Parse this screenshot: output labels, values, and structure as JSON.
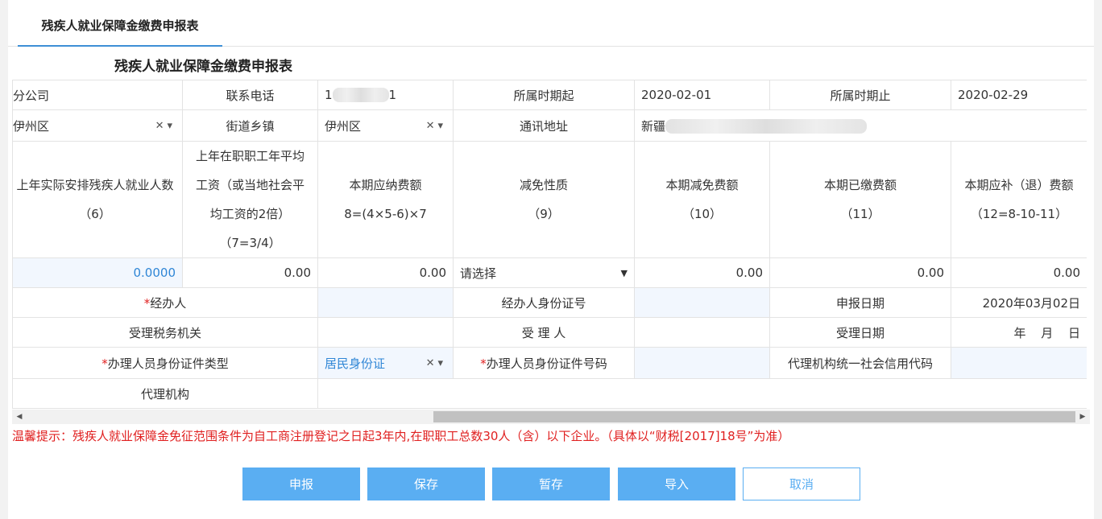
{
  "tab": {
    "label": "残疾人就业保障金缴费申报表"
  },
  "form": {
    "title": "残疾人就业保障金缴费申报表"
  },
  "row1": {
    "company": "分公司",
    "phone_label": "联系电话",
    "phone_prefix": "1",
    "phone_suffix": "1",
    "period_start_label": "所属时期起",
    "period_start": "2020-02-01",
    "period_end_label": "所属时期止",
    "period_end": "2020-02-29"
  },
  "row2": {
    "district_value": "伊州区",
    "street_label": "街道乡镇",
    "street_value": "伊州区",
    "address_label": "通讯地址",
    "address_value": "新疆"
  },
  "headers": {
    "h1_line1": "上年实际安排残疾人就业人数",
    "h1_line2": "（6）",
    "h2_line1": "上年在职职工年平均",
    "h2_line2": "工资（或当地社会平",
    "h2_line3": "均工资的2倍）",
    "h2_line4": "（7=3/4）",
    "h3_line1": "本期应纳费额",
    "h3_line2": "8=(4×5-6)×7",
    "h4_line1": "减免性质",
    "h4_line2": "（9）",
    "h5_line1": "本期减免费额",
    "h5_line2": "（10）",
    "h6_line1": "本期已缴费额",
    "h6_line2": "（11）",
    "h7_line1": "本期应补（退）费额",
    "h7_line2": "（12=8-10-11）"
  },
  "values": {
    "v6": "0.0000",
    "v7": "0.00",
    "v8": "0.00",
    "v9_placeholder": "请选择",
    "v10": "0.00",
    "v11": "0.00",
    "v12": "0.00"
  },
  "row_handler": {
    "handler_label": "经办人",
    "handler_id_label": "经办人身份证号",
    "declare_date_label": "申报日期",
    "declare_date": "2020年03月02日"
  },
  "row_accept": {
    "tax_office_label": "受理税务机关",
    "acceptor_label": "受 理 人",
    "accept_date_label": "受理日期",
    "accept_date": "年 月 日"
  },
  "row_agent": {
    "id_type_label": "办理人员身份证件类型",
    "id_type_value": "居民身份证",
    "id_number_label": "办理人员身份证件号码",
    "agency_code_label": "代理机构统一社会信用代码"
  },
  "row_agency": {
    "agency_label": "代理机构"
  },
  "tip": "温馨提示：残疾人就业保障金免征范围条件为自工商注册登记之日起3年内,在职职工总数30人（含）以下企业。（具体以“财税[2017]18号”为准）",
  "buttons": {
    "declare": "申报",
    "save": "保存",
    "temp_save": "暂存",
    "import": "导入",
    "cancel": "取消"
  },
  "icons": {
    "clear": "clear-x-icon",
    "dropdown": "caret-down-icon"
  },
  "colors": {
    "accent": "#5aaef2",
    "tab_underline": "#3d8fd6",
    "warning": "#e02020",
    "link": "#2f86d6"
  }
}
